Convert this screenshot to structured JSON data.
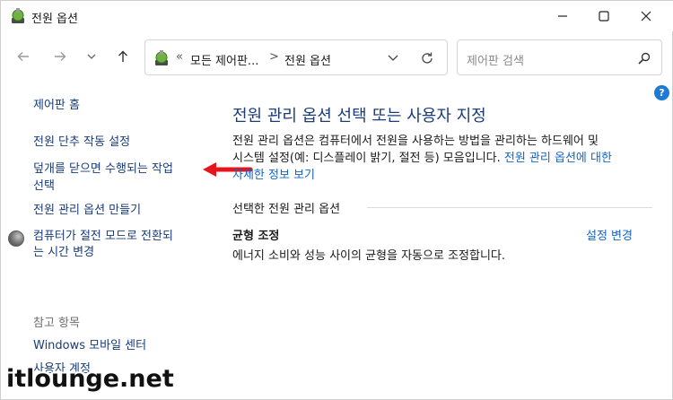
{
  "window": {
    "title": "전원 옵션",
    "controls": {
      "minimize_icon": "minimize-icon",
      "maximize_icon": "maximize-icon",
      "close_icon": "close-icon"
    }
  },
  "nav": {
    "back_icon": "arrow-left-icon",
    "forward_icon": "arrow-right-icon",
    "recent_icon": "chevron-down-icon",
    "up_icon": "arrow-up-icon"
  },
  "address": {
    "overflow": "«",
    "crumb1": "모든 제어판...",
    "separator": ">",
    "crumb2": "전원 옵션",
    "refresh_icon": "refresh-icon"
  },
  "search": {
    "placeholder": "제어판 검색",
    "icon": "search-icon"
  },
  "help": {
    "label": "?"
  },
  "sidebar": {
    "home": "제어판 홈",
    "links": [
      "전원 단추 작동 설정",
      "덮개를 닫으면 수행되는 작업",
      "선택",
      "전원 관리 옵션 만들기",
      "컴퓨터가 절전 모드로 전환되",
      "는 시간 변경"
    ],
    "see_also_heading": "참고 항목",
    "see_also": [
      "Windows 모바일 센터",
      "사용자 계정"
    ]
  },
  "main": {
    "title": "전원 관리 옵션 선택 또는 사용자 지정",
    "desc_line1": "전원 관리 옵션은 컴퓨터에서 전원을 사용하는 방법을 관리하는 하드웨어 및",
    "desc_line2_text": "시스템 설정(예: 디스플레이 밝기, 절전 등) 모음입니다. ",
    "desc_line2_link": "전원 관리 옵션에 대한",
    "desc_line3_link": "자세한 정보 보기",
    "section_label": "선택한 전원 관리 옵션",
    "plan": {
      "name": "균형 조정",
      "change_link": "설정 변경",
      "description": "에너지 소비와 성능 사이의 균형을 자동으로 조정합니다."
    }
  },
  "annotation": {
    "arrow_color": "#e8141c"
  },
  "watermark": {
    "text": "itlounge.net"
  },
  "colors": {
    "link": "#1a3c78",
    "accent_link": "#1565c0",
    "help": "#1f7ad6"
  }
}
